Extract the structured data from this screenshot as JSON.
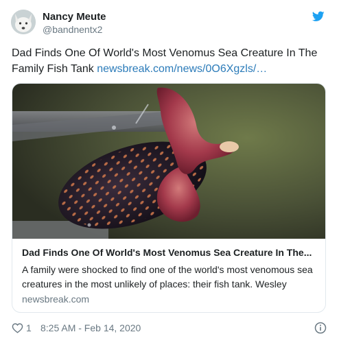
{
  "author": {
    "name": "Nancy Meute",
    "handle": "@bandnentx2"
  },
  "icons": {
    "brand": "twitter-bird-icon",
    "like": "heart-icon",
    "info": "info-icon"
  },
  "colors": {
    "brand_blue": "#1da1f2",
    "link": "#2b7bb9",
    "secondary_text": "#697882",
    "border": "#e1e8ed"
  },
  "tweet": {
    "text": "Dad Finds One Of World's Most Venomus Sea Creature In The Family Fish Tank",
    "link": "newsbreak.com/news/0O6Xgzls/…"
  },
  "card": {
    "title": "Dad Finds One Of World's Most Venomus Sea Creature In The...",
    "description": "A family were shocked to find one of the world's most venomous sea creatures in the most unlikely of places: their fish tank. Wesley",
    "domain": "newsbreak.com"
  },
  "footer": {
    "likes": "1",
    "timestamp": "8:25 AM - Feb 14, 2020"
  }
}
